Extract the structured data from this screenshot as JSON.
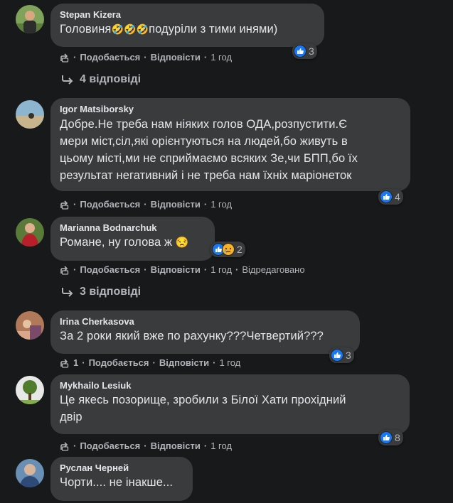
{
  "share_icon": "share-icon",
  "like_color": "#1877f2",
  "comments": [
    {
      "author": "Stepan Kizera",
      "text_before": "Головиня",
      "text_emoji": "🤣🤣🤣",
      "text_after": "подуріли з тими инями)",
      "reactions": "3",
      "like": "Подобається",
      "reply": "Відповісти",
      "time": "1 год",
      "replies": "4 відповіді"
    },
    {
      "author": "Igor Matsiborsky",
      "lines": [
        "Добре.Не треба нам ніяких голов ОДА,розпустити.Є",
        "мери міст,сіл,які орієнтуються на людей,бо живуть в",
        "цьому місті,ми не сприймаємо всяких Зе,чи БПП,бо їх",
        "результат негативний і не треба нам їхніх маріонеток"
      ],
      "reactions": "4",
      "like": "Подобається",
      "reply": "Відповісти",
      "time": "1 год"
    },
    {
      "author": "Marianna Bodnarchuk",
      "text": "Романе, ну голова ж",
      "emoji": "😒",
      "reactions": "2",
      "like": "Подобається",
      "reply": "Відповісти",
      "time": "1 год",
      "edited": "Відредаговано",
      "replies": "3 відповіді"
    },
    {
      "author": "Irina Cherkasova",
      "text": "За 2 роки який вже по рахунку???Четвертий???",
      "reactions": "3",
      "share_count": "1",
      "like": "Подобається",
      "reply": "Відповісти",
      "time": "1 год"
    },
    {
      "author": "Mykhailo Lesiuk",
      "lines": [
        "Це якесь позорище, зробили з Білої Хати прохідний",
        "двір"
      ],
      "reactions": "8",
      "like": "Подобається",
      "reply": "Відповісти",
      "time": "1 год"
    },
    {
      "author": "Руслан Черней",
      "text": "Чорти.... не інакше..."
    }
  ]
}
